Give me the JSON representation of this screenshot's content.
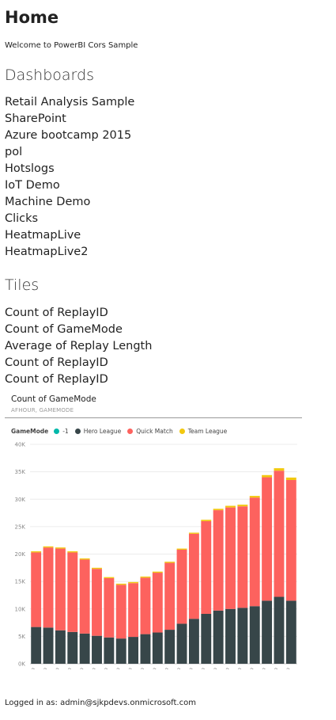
{
  "page": {
    "title": "Home",
    "welcome": "Welcome to PowerBI Cors Sample"
  },
  "dashboards": {
    "heading": "Dashboards",
    "items": [
      "Retail Analysis Sample",
      "SharePoint",
      "Azure bootcamp 2015",
      "pol",
      "Hotslogs",
      "IoT Demo",
      "Machine Demo",
      "Clicks",
      "HeatmapLive",
      "HeatmapLive2"
    ]
  },
  "tiles": {
    "heading": "Tiles",
    "items": [
      "Count of ReplayID",
      "Count of GameMode",
      "Average of Replay Length",
      "Count of ReplayID",
      "Count of ReplayID"
    ]
  },
  "tile": {
    "title": "Count of GameMode",
    "subtitle": "AFHOUR, GAMEMODE",
    "legend_title": "GameMode"
  },
  "colors": {
    "minus_one": "#01B8AA",
    "hero_league": "#374649",
    "quick_match": "#FD625E",
    "team_league": "#F2C80F"
  },
  "chart_data": {
    "type": "bar",
    "stacked": true,
    "categories": [
      "0.00",
      "1.00",
      "2.00",
      "3.00",
      "4.00",
      "5.00",
      "6.00",
      "7.00",
      "8.00",
      "9.00",
      "10.00",
      "11.00",
      "12.00",
      "13.00",
      "14.00",
      "15.00",
      "16.00",
      "17.00",
      "18.00",
      "19.00",
      "20.00",
      "21.00"
    ],
    "series": [
      {
        "name": "-1",
        "color": "#01B8AA",
        "values": [
          0,
          0,
          0,
          0,
          0,
          0,
          0,
          0,
          0,
          0,
          0,
          0,
          0,
          0,
          0,
          0,
          0,
          0,
          0,
          0,
          0,
          0
        ]
      },
      {
        "name": "Hero League",
        "color": "#374649",
        "values": [
          6700,
          6600,
          6100,
          5800,
          5500,
          5100,
          4800,
          4600,
          4900,
          5400,
          5700,
          6200,
          7300,
          8200,
          9100,
          9700,
          10000,
          10200,
          10500,
          11500,
          12200,
          11500
        ]
      },
      {
        "name": "Quick Match",
        "color": "#FD625E",
        "values": [
          13600,
          14600,
          14900,
          14500,
          13500,
          12200,
          10800,
          9800,
          9800,
          10300,
          10900,
          12200,
          13500,
          15500,
          16900,
          18300,
          18500,
          18500,
          19800,
          22500,
          23000,
          22000
        ]
      },
      {
        "name": "Team League",
        "color": "#F2C80F",
        "values": [
          200,
          200,
          200,
          200,
          200,
          200,
          200,
          200,
          200,
          200,
          200,
          200,
          200,
          200,
          250,
          250,
          300,
          300,
          300,
          400,
          450,
          450
        ]
      }
    ],
    "yticks": [
      "0K",
      "5K",
      "10K",
      "15K",
      "20K",
      "25K",
      "30K",
      "35K",
      "40K"
    ],
    "ylim": [
      0,
      40000
    ],
    "grid": true,
    "legend": "top-left"
  },
  "footer": {
    "text": "Logged in as: admin@sjkpdevs.onmicrosoft.com"
  }
}
